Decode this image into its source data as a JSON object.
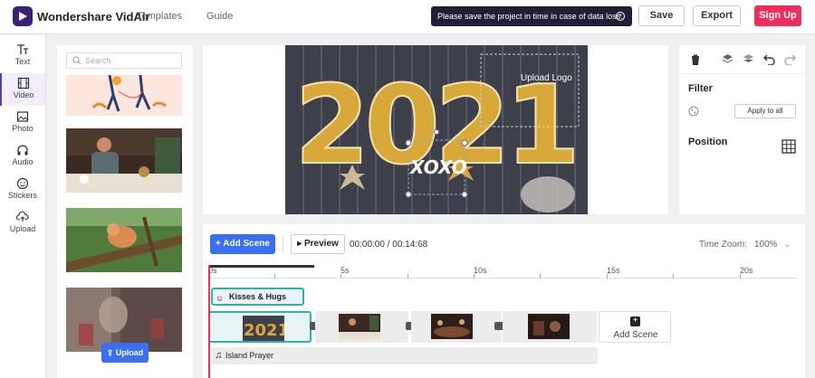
{
  "header": {
    "app_title": "Wondershare VidAir",
    "nav": [
      "Templates",
      "Guide"
    ],
    "notice": "Please save the project in time in case of data loss.",
    "save_label": "Save",
    "export_label": "Export",
    "signup_label": "Sign Up"
  },
  "rail": {
    "items": [
      {
        "label": "Text",
        "icon": "text-icon"
      },
      {
        "label": "Video",
        "icon": "film-icon"
      },
      {
        "label": "Photo",
        "icon": "image-icon"
      },
      {
        "label": "Audio",
        "icon": "headphones-icon"
      },
      {
        "label": "Stickers",
        "icon": "smiley-icon"
      },
      {
        "label": "Upload",
        "icon": "upload-icon"
      }
    ],
    "active": "Video"
  },
  "media": {
    "search_placeholder": "Search",
    "upload_label": "Upload"
  },
  "preview": {
    "upload_logo_label": "Upload Logo",
    "overlay_text": "XOXO",
    "video_text": "2021"
  },
  "props": {
    "filter_title": "Filter",
    "apply_all_label": "Apply to all",
    "position_title": "Position"
  },
  "timeline": {
    "add_scene_label": "Add Scene",
    "preview_label": "Preview",
    "timecode": "00:00:00 / 00:14:68",
    "zoom_label": "Time Zoom:",
    "zoom_value": "100%",
    "ticks": [
      "0s",
      "5s",
      "10s",
      "15s",
      "20s"
    ],
    "text_clip": "Kisses & Hugs",
    "add_scene_tile": "Add Scene",
    "audio_clip": "Island Prayer"
  },
  "colors": {
    "accent_blue": "#3b6ff2",
    "signup_red": "#ee2d5c",
    "selection_teal": "#2bb5a5",
    "playhead": "#e53156",
    "notice_bg": "#1f2035"
  }
}
